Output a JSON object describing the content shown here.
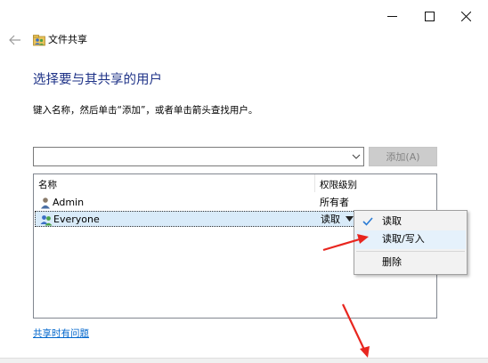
{
  "window": {
    "title": "文件共享",
    "controls": [
      "minimize",
      "maximize",
      "close"
    ]
  },
  "heading": "选择要与其共享的用户",
  "instruction": "键入名称，然后单击“添加”，或者单击箭头查找用户。",
  "user_input": {
    "value": "",
    "placeholder": ""
  },
  "add_button_label": "添加(A)",
  "table": {
    "columns": [
      "名称",
      "权限级别"
    ],
    "rows": [
      {
        "name": "Admin",
        "permission": "所有者",
        "icon": "user-icon",
        "selected": false
      },
      {
        "name": "Everyone",
        "permission": "读取",
        "icon": "group-icon",
        "selected": true
      }
    ]
  },
  "permission_menu": {
    "items": [
      {
        "label": "读取",
        "checked": true
      },
      {
        "label": "读取/写入",
        "checked": false,
        "highlighted": true
      },
      {
        "label": "删除",
        "checked": false
      }
    ]
  },
  "help_link": "共享时有问题",
  "colors": {
    "heading": "#1e3287",
    "link": "#0066cc",
    "selection": "#d9ebf9",
    "menu_bg": "#f2f2f2",
    "annotation_arrow": "#e8261f",
    "check": "#2a7bd4"
  }
}
